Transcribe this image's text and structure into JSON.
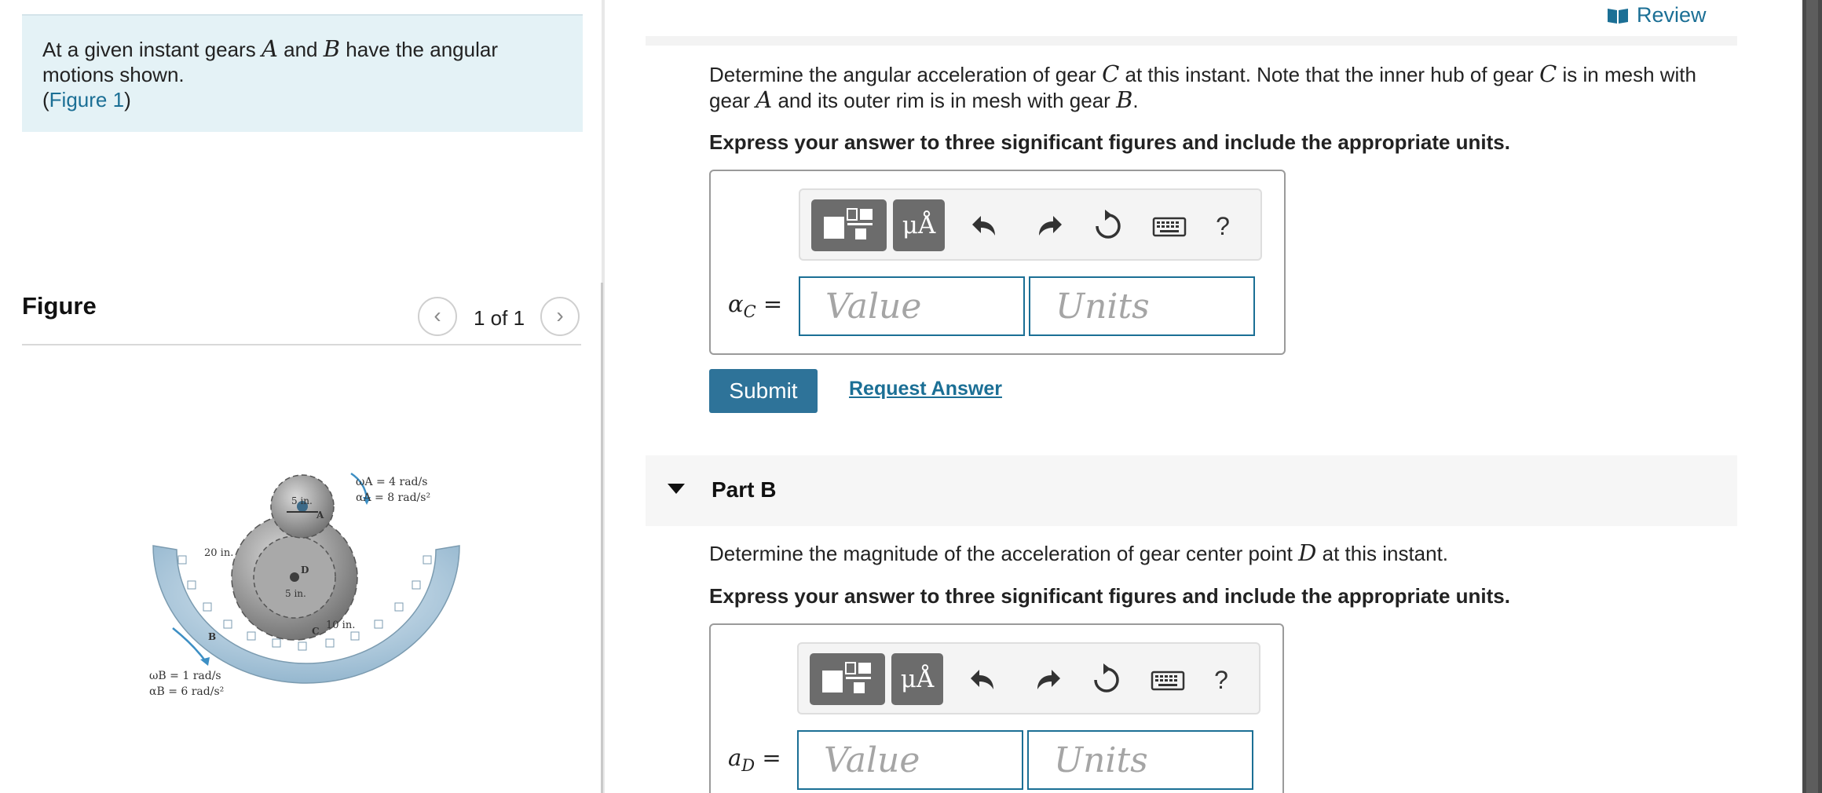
{
  "problem": {
    "text_before": "At a given instant gears ",
    "var_a": "A",
    "text_and": " and ",
    "var_b": "B",
    "text_after": " have the angular motions shown.",
    "figure_link": "Figure 1",
    "open_paren": "(",
    "close_paren": ")"
  },
  "figure": {
    "title": "Figure",
    "count": "1 of 1",
    "prev_glyph": "‹",
    "next_glyph": "›",
    "labels": {
      "omega_a": "ωA = 4 rad/s",
      "alpha_a": "αA = 8 rad/s²",
      "omega_b": "ωB = 1 rad/s",
      "alpha_b": "αB = 6 rad/s²",
      "r5a": "5 in.",
      "r20": "20 in.",
      "r5d": "5 in.",
      "r10": "10 in.",
      "gear_a": "A",
      "gear_b": "B",
      "gear_c": "C",
      "gear_d": "D"
    }
  },
  "review": {
    "label": "Review"
  },
  "partA": {
    "q1": "Determine the angular acceleration of gear ",
    "v1": "C",
    "q2": " at this instant. Note that the inner hub of gear ",
    "v2": "C",
    "q3": " is in mesh with gear ",
    "v3": "A",
    "q4": " and its outer rim is in mesh with gear ",
    "v4": "B",
    "q5": ".",
    "instruction": "Express your answer to three significant figures and include the appropriate units.",
    "answer_symbol": "α",
    "answer_sub": "C",
    "equals": " =",
    "value_placeholder": "Value",
    "units_placeholder": "Units",
    "submit": "Submit",
    "request": "Request Answer"
  },
  "partB": {
    "title": "Part B",
    "q1": "Determine the magnitude of the acceleration of gear center point ",
    "v1": "D",
    "q2": " at this instant.",
    "instruction": "Express your answer to three significant figures and include the appropriate units.",
    "answer_symbol": "a",
    "answer_sub": "D",
    "equals": " =",
    "value_placeholder": "Value",
    "units_placeholder": "Units"
  },
  "toolbar": {
    "units_glyph": "μÅ",
    "help_glyph": "?",
    "icons": [
      "templates-icon",
      "units-icon",
      "undo-icon",
      "redo-icon",
      "reset-icon",
      "keyboard-icon",
      "help-icon"
    ]
  },
  "colors": {
    "accent": "#1b6f95",
    "submit_bg": "#2e7399",
    "problem_bg": "#e4f2f6",
    "toolbar_btn": "#6c6c6c"
  }
}
